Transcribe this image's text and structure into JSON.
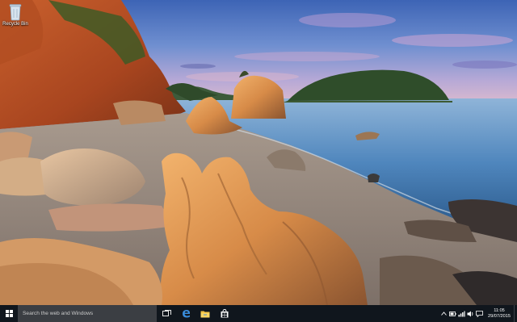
{
  "desktop": {
    "icons": [
      {
        "label": "Recycle Bin",
        "icon": "recycle-bin-icon"
      }
    ],
    "wallpaper": "rocky beach with sea stack and island at dusk"
  },
  "taskbar": {
    "start_icon": "windows-logo-icon",
    "search_placeholder": "Search the web and Windows",
    "pinned": [
      {
        "name": "task-view",
        "icon": "task-view-icon"
      },
      {
        "name": "edge",
        "icon": "edge-icon"
      },
      {
        "name": "file-explorer",
        "icon": "folder-icon"
      },
      {
        "name": "store",
        "icon": "store-icon"
      }
    ],
    "tray": {
      "icons": [
        "chevron-up-icon",
        "battery-icon",
        "network-icon",
        "volume-icon",
        "notifications-icon"
      ],
      "time": "11:05",
      "date": "29/07/2015"
    },
    "colors": {
      "bar": "#10161d",
      "search": "#3b3e43",
      "accent": "#8fb5e0"
    }
  }
}
